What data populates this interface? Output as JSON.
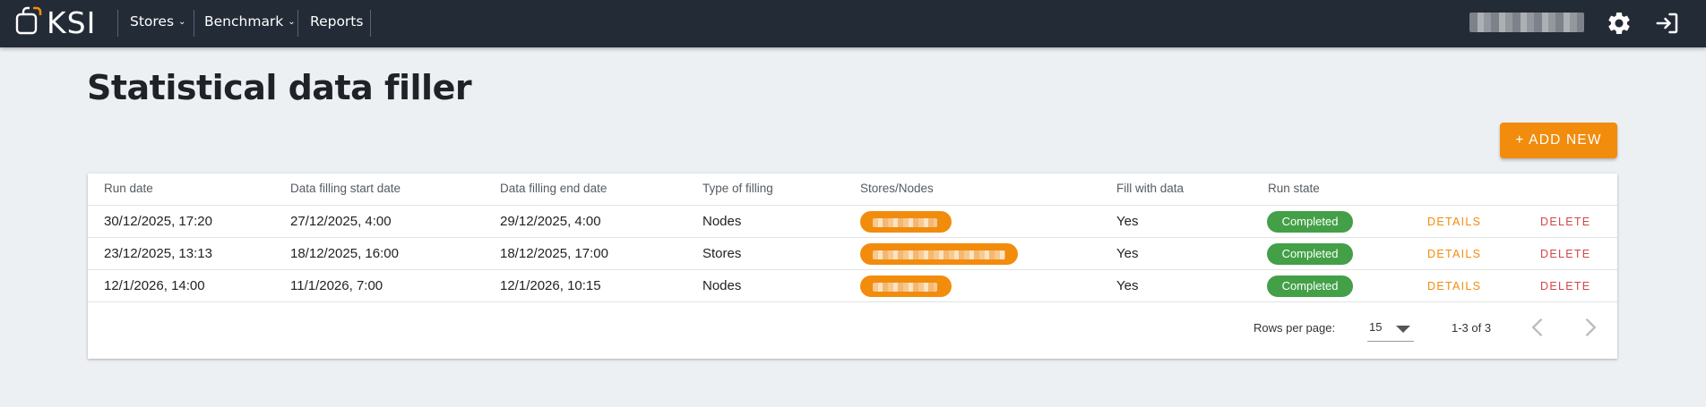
{
  "header": {
    "logo_text": "KSI",
    "nav": [
      {
        "label": "Stores",
        "has_dropdown": true
      },
      {
        "label": "Benchmark",
        "has_dropdown": true
      },
      {
        "label": "Reports",
        "has_dropdown": false
      }
    ],
    "icons": [
      "settings-gear-icon",
      "logout-icon"
    ],
    "brand_color": "#f28c0c",
    "bar_color": "#232b36"
  },
  "page": {
    "title": "Statistical data filler",
    "add_button_label": "+ ADD NEW"
  },
  "table": {
    "columns": [
      "Run date",
      "Data filling start date",
      "Data filling end date",
      "Type of filling",
      "Stores/Nodes",
      "Fill with data",
      "Run state"
    ],
    "rows": [
      {
        "run_date": "30/12/2025, 17:20",
        "start_date": "27/12/2025, 4:00",
        "end_date": "29/12/2025, 4:00",
        "type": "Nodes",
        "fill": "Yes",
        "state": "Completed",
        "details": "DETAILS",
        "delete": "DELETE"
      },
      {
        "run_date": "23/12/2025, 13:13",
        "start_date": "18/12/2025, 16:00",
        "end_date": "18/12/2025, 17:00",
        "type": "Stores",
        "fill": "Yes",
        "state": "Completed",
        "details": "DETAILS",
        "delete": "DELETE"
      },
      {
        "run_date": "12/1/2026, 14:00",
        "start_date": "11/1/2026, 7:00",
        "end_date": "12/1/2026, 10:15",
        "type": "Nodes",
        "fill": "Yes",
        "state": "Completed",
        "details": "DETAILS",
        "delete": "DELETE"
      }
    ],
    "state_color": "#43a047",
    "delete_color": "#d24747"
  },
  "pagination": {
    "rows_per_page_label": "Rows per page:",
    "rows_per_page_value": "15",
    "range": "1-3 of 3"
  }
}
